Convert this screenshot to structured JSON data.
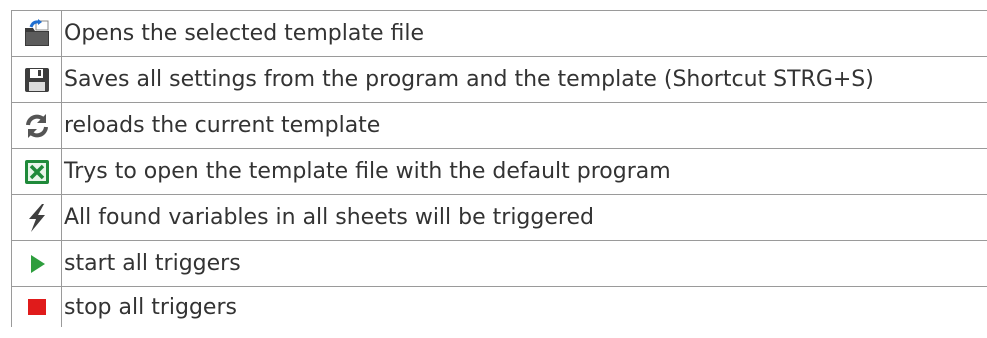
{
  "rows": [
    {
      "icon": "open-folder-icon",
      "text": "Opens the selected template file"
    },
    {
      "icon": "save-floppy-icon",
      "text": "Saves all settings from the program and the template (Shortcut STRG+S)"
    },
    {
      "icon": "reload-icon",
      "text": "reloads the current template"
    },
    {
      "icon": "excel-icon",
      "text": "Trys to open the template file with the default program"
    },
    {
      "icon": "lightning-icon",
      "text": "All found variables in all sheets will be triggered"
    },
    {
      "icon": "play-icon",
      "text": "start all triggers"
    },
    {
      "icon": "stop-icon",
      "text": "stop all triggers"
    }
  ],
  "colors": {
    "border": "#9a9a9a",
    "text": "#333333",
    "play": "#2e9e3e",
    "stop": "#e01b1b",
    "excel": "#1f8a3a"
  }
}
